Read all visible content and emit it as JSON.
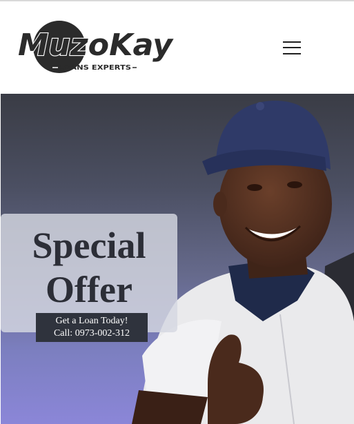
{
  "header": {
    "logo": {
      "wordmark": "MuzoKay",
      "tagline": "LOANS EXPERTS",
      "colors": {
        "dark": "#2b2b2b",
        "white": "#ffffff"
      }
    },
    "menu_icon": "hamburger-menu-icon"
  },
  "hero": {
    "offer": {
      "title_line1": "Special",
      "title_line2": "Offer",
      "cta_line1": "Get a Loan Today!",
      "cta_line2": "Call: 0973-002-312"
    },
    "colors": {
      "card": "#d6d8e2",
      "title": "#2c2e37",
      "cta_bg": "#2f333d",
      "background_accent": "#8b86d8"
    }
  }
}
